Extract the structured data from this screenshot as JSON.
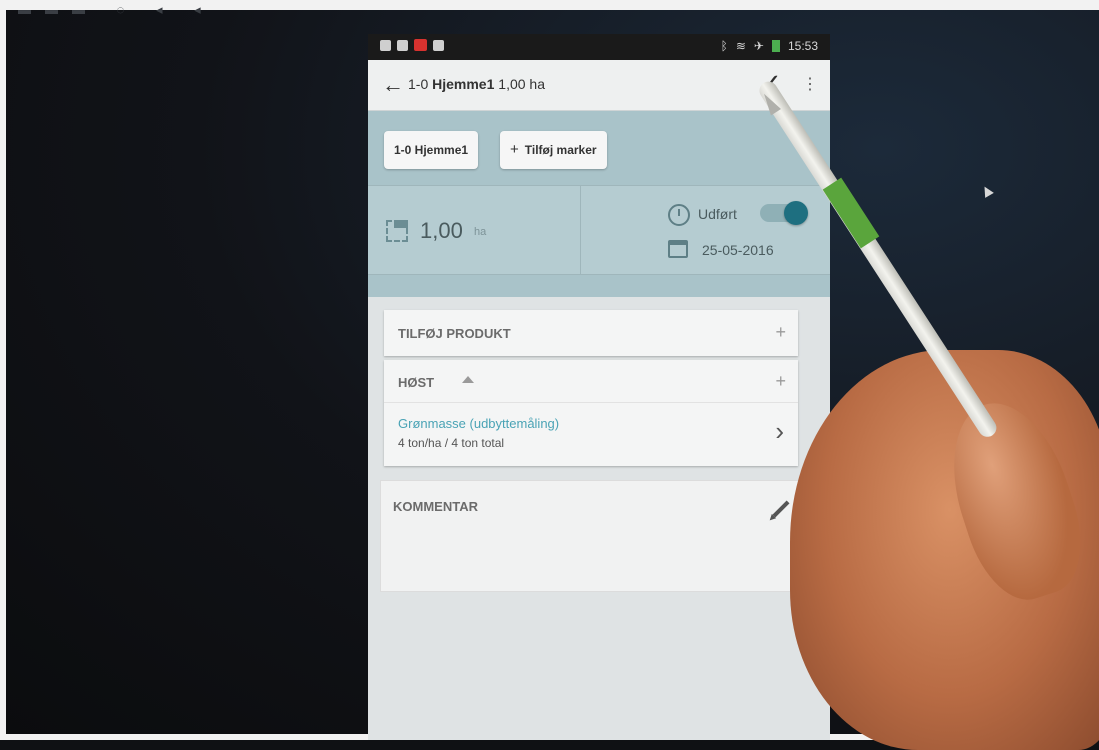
{
  "statusbar": {
    "time": "15:53"
  },
  "appbar": {
    "field_prefix": "1-0",
    "field_name": "Hjemme1",
    "area": "1,00 ha",
    "confirm_icon": "check-icon",
    "more_icon": "overflow-menu-icon"
  },
  "chips": {
    "field_chip": "1-0 Hjemme1",
    "add_fields_label": "Tilføj marker"
  },
  "summary": {
    "area_value": "1,00",
    "area_unit": "ha",
    "status_label": "Udført",
    "status_done": true,
    "date": "25-05-2016"
  },
  "products": {
    "add_product_label": "TILFØJ PRODUKT"
  },
  "harvest": {
    "section_label": "HØST",
    "measurement_name": "Grønmasse (udbyttemåling)",
    "measurement_value": "4 ton/ha  /  4 ton total"
  },
  "comment": {
    "label": "KOMMENTAR"
  },
  "colors": {
    "accent_teal": "#4aa3b5",
    "panel_teal": "#a9c3c9",
    "toggle_on": "#1e6f80"
  }
}
